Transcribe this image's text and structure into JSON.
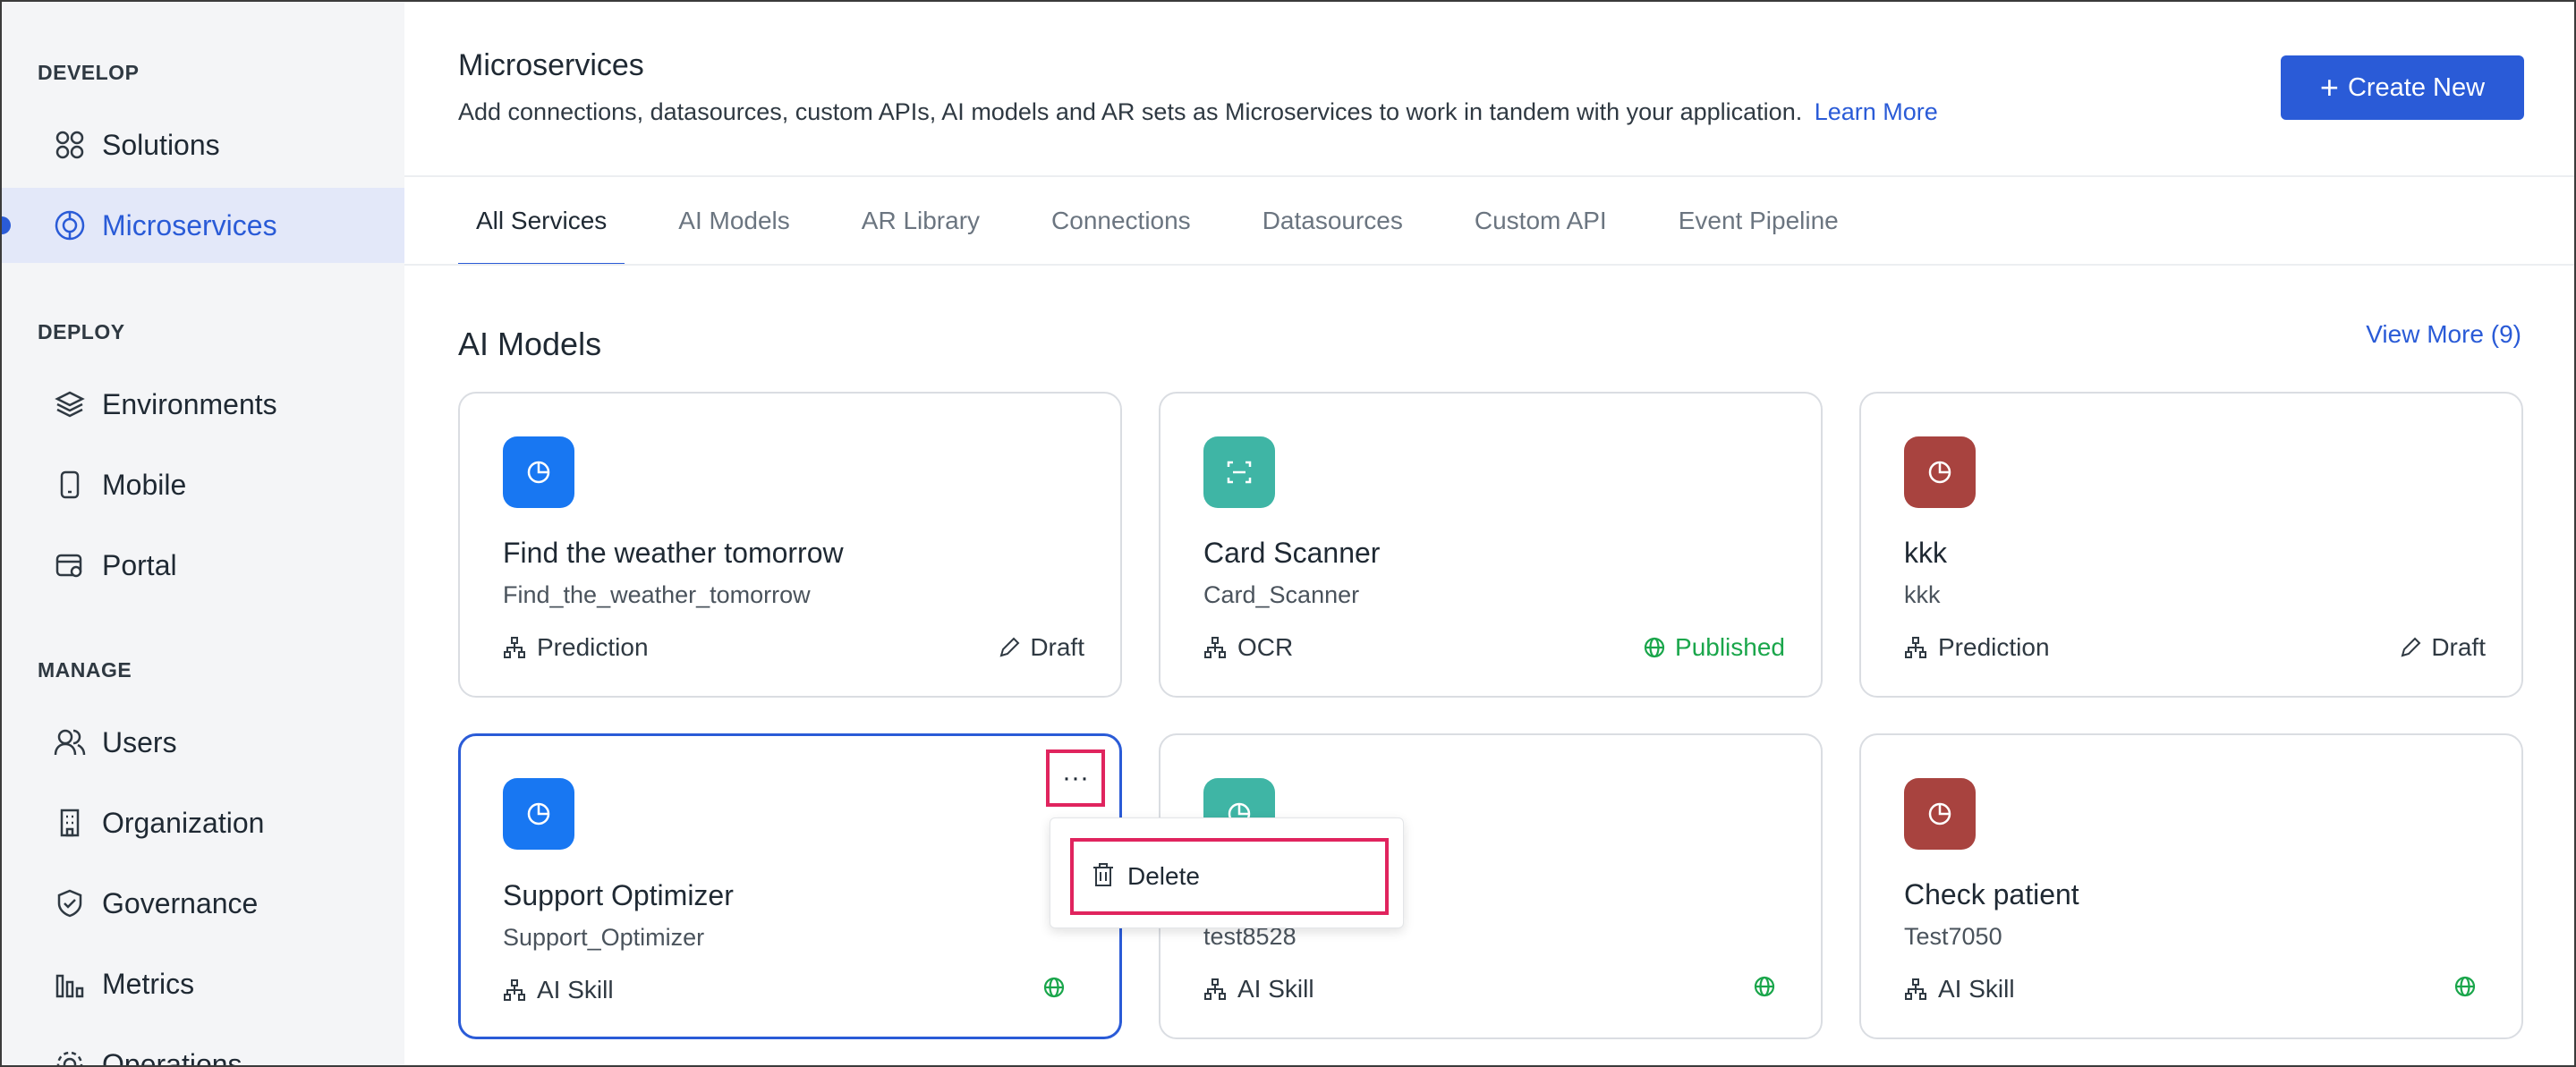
{
  "sidebar": {
    "sections": [
      {
        "title": "DEVELOP"
      },
      {
        "title": "DEPLOY"
      },
      {
        "title": "MANAGE"
      }
    ],
    "items": [
      {
        "label": "Solutions",
        "icon": "grid-icon"
      },
      {
        "label": "Microservices",
        "icon": "microservices-icon",
        "active": true
      },
      {
        "label": "Environments",
        "icon": "layers-icon"
      },
      {
        "label": "Mobile",
        "icon": "mobile-icon"
      },
      {
        "label": "Portal",
        "icon": "portal-icon"
      },
      {
        "label": "Users",
        "icon": "users-icon"
      },
      {
        "label": "Organization",
        "icon": "building-icon"
      },
      {
        "label": "Governance",
        "icon": "shield-icon"
      },
      {
        "label": "Metrics",
        "icon": "bar-chart-icon"
      },
      {
        "label": "Operations",
        "icon": "gear-icon"
      }
    ]
  },
  "header": {
    "title": "Microservices",
    "subtitle": "Add connections, datasources, custom APIs, AI models and AR sets as Microservices to work in tandem with your application.",
    "learn_more": "Learn More",
    "create_label": "Create New"
  },
  "tabs": [
    {
      "label": "All Services",
      "active": true
    },
    {
      "label": "AI Models"
    },
    {
      "label": "AR Library"
    },
    {
      "label": "Connections"
    },
    {
      "label": "Datasources"
    },
    {
      "label": "Custom API"
    },
    {
      "label": "Event Pipeline"
    }
  ],
  "section": {
    "title": "AI Models",
    "view_more": "View More (9)"
  },
  "cards": [
    {
      "name": "Find the weather tomorrow",
      "code": "Find_the_weather_tomorrow",
      "type": "Prediction",
      "status": "Draft",
      "color": "#1877f2"
    },
    {
      "name": "Card Scanner",
      "code": "Card_Scanner",
      "type": "OCR",
      "status": "Published",
      "color": "#3fb5a5"
    },
    {
      "name": "kkk",
      "code": "kkk",
      "type": "Prediction",
      "status": "Draft",
      "color": "#a8433f"
    },
    {
      "name": "Support Optimizer",
      "code": "Support_Optimizer",
      "type": "AI Skill",
      "status": "",
      "color": "#1877f2"
    },
    {
      "name": "",
      "code": "test8528",
      "type": "AI Skill",
      "status": "",
      "color": "#3fb5a5"
    },
    {
      "name": "Check patient",
      "code": "Test7050",
      "type": "AI Skill",
      "status": "",
      "color": "#a8433f"
    }
  ],
  "context_menu": {
    "more_label": "···",
    "delete_label": "Delete"
  }
}
